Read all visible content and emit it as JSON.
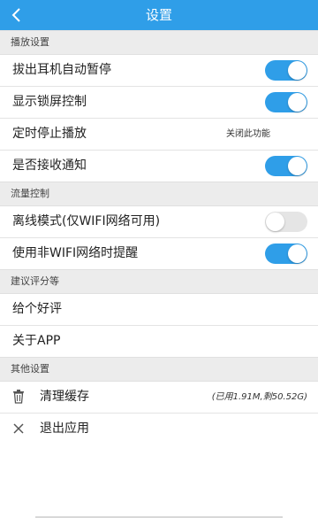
{
  "header": {
    "title": "设置"
  },
  "sections": {
    "playback": {
      "label": "播放设置"
    },
    "traffic": {
      "label": "流量控制"
    },
    "suggest": {
      "label": "建议评分等"
    },
    "other": {
      "label": "其他设置"
    }
  },
  "rows": {
    "auto_pause": {
      "label": "拔出耳机自动暂停",
      "toggle": "on"
    },
    "lock_screen": {
      "label": "显示锁屏控制",
      "toggle": "on"
    },
    "timer_stop": {
      "label": "定时停止播放",
      "value": "关闭此功能"
    },
    "notifications": {
      "label": "是否接收通知",
      "toggle": "on"
    },
    "offline_mode": {
      "label": "离线模式(仅WIFI网络可用)",
      "toggle": "off"
    },
    "non_wifi_alert": {
      "label": "使用非WIFI网络时提醒",
      "toggle": "on"
    },
    "rate": {
      "label": "给个好评"
    },
    "about": {
      "label": "关于APP"
    },
    "clear_cache": {
      "label": "清理缓存",
      "value": "(已用1.91M,剩50.52G)"
    },
    "exit": {
      "label": "退出应用"
    }
  },
  "colors": {
    "accent": "#2f9ee8",
    "section_bg": "#ececec"
  }
}
